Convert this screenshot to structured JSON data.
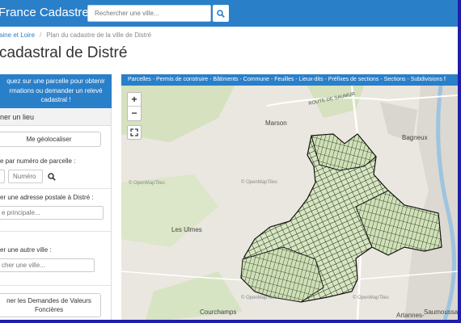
{
  "header": {
    "brand": "France Cadastre",
    "search_placeholder": "Rechercher une ville..."
  },
  "breadcrumb": {
    "items": [
      "aine et Loire",
      "Plan du cadastre de la ville de Distré"
    ]
  },
  "page": {
    "title": "cadastral de Distré"
  },
  "info_box": {
    "lines": [
      "quez sur une parcelle pour obtenir",
      "rmations ou demander un relevé",
      "cadastral !"
    ]
  },
  "sidebar": {
    "heading": "ner un lieu",
    "geolocate_label": "Me géolocaliser",
    "parcel_label": "e par numéro de parcelle :",
    "parcel_number_placeholder": "Numéro",
    "address_label": "er une adresse postale à Distré :",
    "address_placeholder": "e principale...",
    "other_city_label": "er une autre ville :",
    "other_city_placeholder": "cher une ville...",
    "dvf_label": [
      "ner les Demandes de Valeurs",
      "Foncières"
    ]
  },
  "map": {
    "layer_bar": "Parcelles - Permis de construire - Bâtiments - Commune - Feuilles - Lieux-dits - Préfixes de sections - Sections - Subdivisions f",
    "zoom_in": "+",
    "zoom_out": "−",
    "labels": {
      "marson": "Marson",
      "bagneux": "Bagneux",
      "les_ulmes": "Les Ulmes",
      "courchamps": "Courchamps",
      "artannes": "Artannes-",
      "saumoussay": "Saumoussay",
      "route": "ROUTE DE SAUMUR"
    },
    "watermark": "© OpenMapTiles"
  },
  "colors": {
    "primary": "#2a7fc9",
    "parcel_fill": "#d6e7c0",
    "parcel_stroke": "#1a1a1a"
  }
}
